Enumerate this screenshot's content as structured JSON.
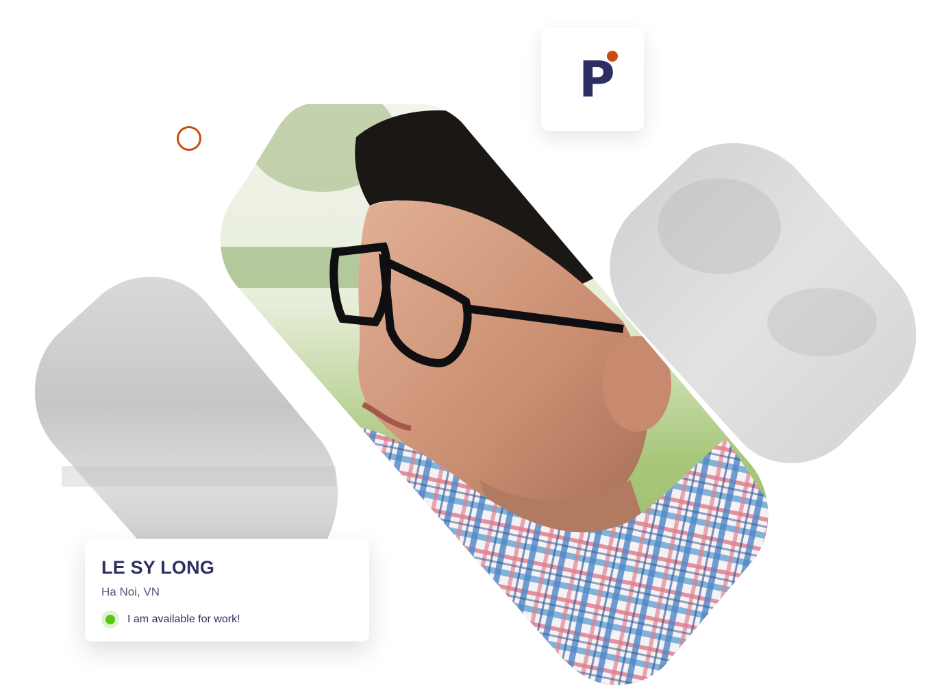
{
  "profile": {
    "name": "LE SY LONG",
    "location": "Ha Noi, VN",
    "status": "I am available for work!"
  },
  "logo": {
    "letter": "P",
    "letter_color": "#2d2f63",
    "dot_color": "#c74b12"
  },
  "colors": {
    "accent": "#c74b12",
    "primary_text": "#2d2f63",
    "status_green": "#5bc514"
  },
  "icons": {
    "status": "online-dot-icon",
    "decoration": "ring-outline-icon"
  }
}
